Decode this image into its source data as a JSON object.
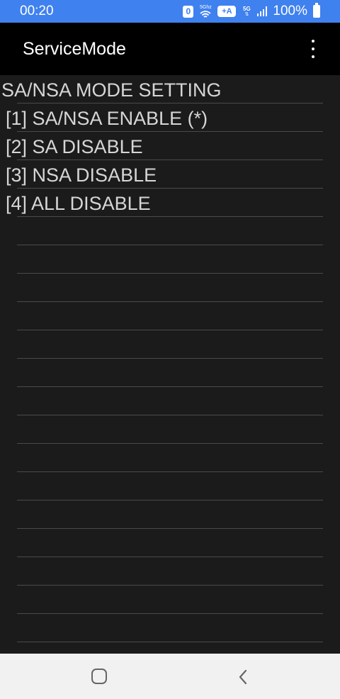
{
  "status_bar": {
    "time": "00:20",
    "badge_zero": "0",
    "wifi_band": "5Ghz",
    "plus_a": "+A",
    "network": "5G",
    "battery": "100%",
    "icons": [
      "notification-zero-icon",
      "wifi-icon",
      "plus-a-icon",
      "5g-icon",
      "signal-icon",
      "battery-icon"
    ]
  },
  "app_bar": {
    "title": "ServiceMode",
    "menu_icon": "more-vert-icon"
  },
  "content": {
    "header": "SA/NSA MODE SETTING",
    "items": [
      {
        "label": "[1] SA/NSA ENABLE (*)"
      },
      {
        "label": "[2] SA DISABLE"
      },
      {
        "label": "[3] NSA DISABLE"
      },
      {
        "label": "[4] ALL DISABLE"
      }
    ],
    "empty_rows": 15
  },
  "nav_bar": {
    "icons": [
      "home-icon",
      "back-icon"
    ]
  },
  "colors": {
    "status_bar": "#3f81ee",
    "app_bar": "#000000",
    "background": "#1b1b1b",
    "text": "#d6d6d6",
    "divider": "#4a4a4a",
    "nav_bar": "#f1f1f1"
  }
}
